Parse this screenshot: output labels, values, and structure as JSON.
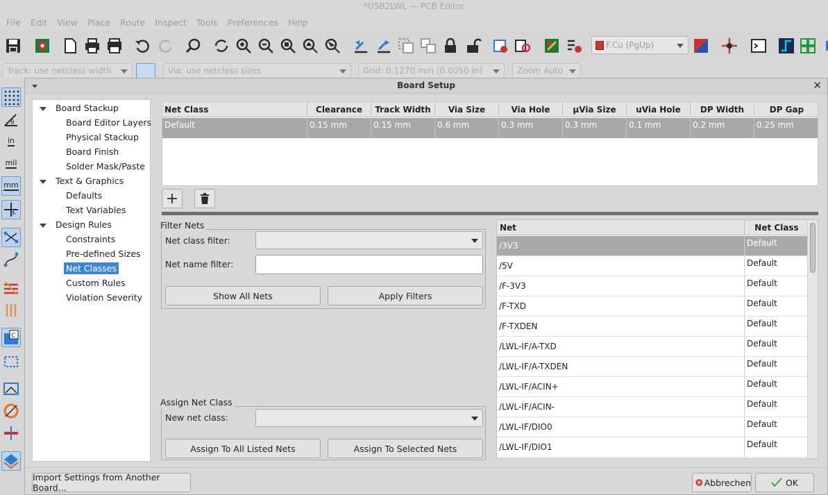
{
  "window": {
    "title": "*USB2LWL — PCB Editor"
  },
  "menubar": [
    "File",
    "Edit",
    "View",
    "Place",
    "Route",
    "Inspect",
    "Tools",
    "Preferences",
    "Help"
  ],
  "toolbar": {
    "icons": [
      "save-icon",
      "board-setup-icon",
      "page-settings-icon",
      "print-icon",
      "plot-icon",
      "undo-icon",
      "redo-icon",
      "find-icon",
      "refresh-icon",
      "zoom-in-icon",
      "zoom-out-icon",
      "zoom-fit-icon",
      "zoom-objects-icon",
      "zoom-selection-icon",
      "rotate-ccw-icon",
      "rotate-cw-icon",
      "group-icon",
      "ungroup-icon",
      "lock-icon",
      "unlock-icon",
      "footprint-editor-icon",
      "footprint-browser-icon",
      "update-from-schematic-icon",
      "drc-icon"
    ],
    "layer_selector": "F.Cu (PgUp)",
    "layer_color": "#c83434"
  },
  "toolbar2": {
    "track": "Track: use netclass width",
    "via": "Via: use netclass sizes",
    "grid": "Grid: 0.1270 mm (0.0050 in)",
    "zoom": "Zoom Auto"
  },
  "left_toolbar": {
    "units": {
      "in": "in",
      "mil": "mil",
      "mm": "mm"
    }
  },
  "dialog": {
    "title": "Board Setup",
    "tree": [
      {
        "label": "Board Stackup",
        "level": 0,
        "expanded": true
      },
      {
        "label": "Board Editor Layers",
        "level": 1
      },
      {
        "label": "Physical Stackup",
        "level": 1
      },
      {
        "label": "Board Finish",
        "level": 1
      },
      {
        "label": "Solder Mask/Paste",
        "level": 1
      },
      {
        "label": "Text & Graphics",
        "level": 0,
        "expanded": true
      },
      {
        "label": "Defaults",
        "level": 1
      },
      {
        "label": "Text Variables",
        "level": 1
      },
      {
        "label": "Design Rules",
        "level": 0,
        "expanded": true
      },
      {
        "label": "Constraints",
        "level": 1
      },
      {
        "label": "Pre-defined Sizes",
        "level": 1
      },
      {
        "label": "Net Classes",
        "level": 1,
        "selected": true
      },
      {
        "label": "Custom Rules",
        "level": 1
      },
      {
        "label": "Violation Severity",
        "level": 1
      }
    ],
    "netclass_table": {
      "columns": [
        "Net Class",
        "Clearance",
        "Track Width",
        "Via Size",
        "Via Hole",
        "μVia Size",
        "uVia Hole",
        "DP Width",
        "DP Gap"
      ],
      "rows": [
        [
          "Default",
          "0.15 mm",
          "0.15 mm",
          "0.6 mm",
          "0.3 mm",
          "0.3 mm",
          "0.1 mm",
          "0.2 mm",
          "0.25 mm"
        ]
      ]
    },
    "filter_nets": {
      "title": "Filter Nets",
      "netclass_filter_label": "Net class filter:",
      "netclass_filter_value": "",
      "netname_filter_label": "Net name filter:",
      "netname_filter_value": "",
      "show_all_label": "Show All Nets",
      "apply_label": "Apply Filters"
    },
    "assign": {
      "title": "Assign Net Class",
      "new_class_label": "New net class:",
      "new_class_value": "",
      "assign_all_label": "Assign To All Listed Nets",
      "assign_selected_label": "Assign To Selected Nets"
    },
    "nets_table": {
      "columns": [
        "Net",
        "Net Class"
      ],
      "rows": [
        [
          "/3V3",
          "Default"
        ],
        [
          "/5V",
          "Default"
        ],
        [
          "/F-3V3",
          "Default"
        ],
        [
          "/F-TXD",
          "Default"
        ],
        [
          "/F-TXDEN",
          "Default"
        ],
        [
          "/LWL-IF/A-TXD",
          "Default"
        ],
        [
          "/LWL-IF/A-TXDEN",
          "Default"
        ],
        [
          "/LWL-IF/ACIN+",
          "Default"
        ],
        [
          "/LWL-IF/ACIN-",
          "Default"
        ],
        [
          "/LWL-IF/DIO0",
          "Default"
        ],
        [
          "/LWL-IF/DIO1",
          "Default"
        ]
      ]
    },
    "import_label": "Import Settings from Another Board...",
    "cancel_label": "Abbrechen",
    "ok_label": "OK"
  }
}
